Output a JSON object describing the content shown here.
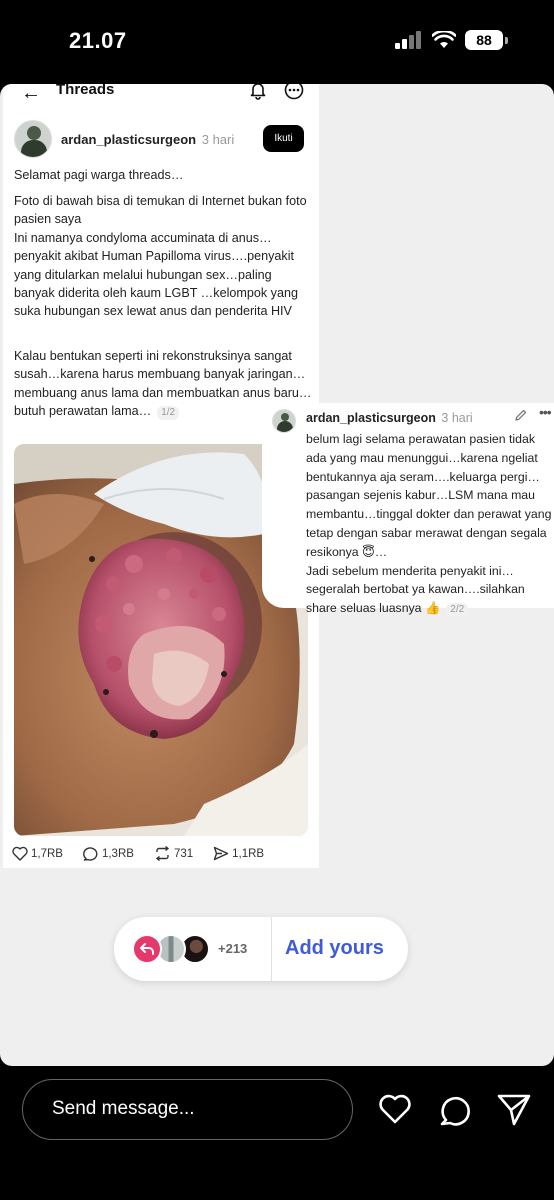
{
  "status_bar": {
    "time": "21.07",
    "battery": "88"
  },
  "threads": {
    "title": "Threads"
  },
  "post": {
    "username": "ardan_plasticsurgeon",
    "time_ago": "3 hari",
    "follow_label": "Ikuti",
    "paragraph_1": "Selamat pagi warga threads…",
    "paragraph_2": "Foto di bawah bisa di temukan di Internet bukan foto pasien saya\nIni namanya condyloma accuminata di anus…\npenyakit akibat Human Papilloma virus….penyakit yang ditularkan melalui hubungan sex…paling banyak diderita oleh kaum LGBT …kelompok yang suka hubungan sex lewat anus dan penderita HIV",
    "paragraph_3": "Kalau bentukan seperti ini rekonstruksinya sangat susah…karena harus membuang banyak jaringan…membuang anus lama dan membuatkan anus baru…butuh perawatan lama…",
    "page_tag": "1/2",
    "likes": "1,7RB",
    "comments": "1,3RB",
    "reposts": "731",
    "shares": "1,1RB"
  },
  "reply": {
    "username": "ardan_plasticsurgeon",
    "time_ago": "3 hari",
    "text": "belum lagi selama perawatan pasien tidak ada yang mau menunggui…karena ngeliat bentukannya aja seram….keluarga pergi…pasangan sejenis kabur…LSM mana mau membantu…tinggal dokter dan perawat yang tetap dengan sabar merawat dengan segala resikonya 😇…\nJadi sebelum menderita penyakit ini…segeralah bertobat ya kawan….silahkan share seluas luasnya 👍",
    "page_tag": "2/2"
  },
  "add_yours": {
    "count": "+213",
    "label": "Add yours"
  },
  "bottom": {
    "message_placeholder": "Send message..."
  },
  "colors": {
    "add_yours_accent": "#3f5bd6",
    "reply_badge": "#e4396a"
  }
}
